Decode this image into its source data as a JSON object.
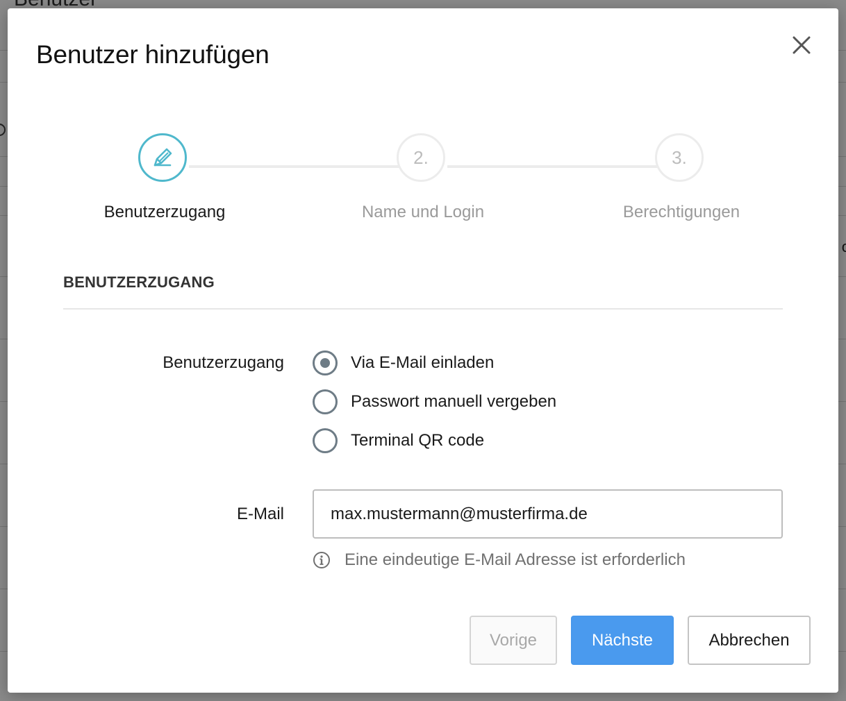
{
  "background": {
    "page_title": "Benutzer"
  },
  "modal": {
    "title": "Benutzer hinzufügen",
    "close_icon": "close-icon",
    "steps": [
      {
        "label": "Benutzerzugang",
        "marker": "",
        "icon": "pencil-icon",
        "state": "active"
      },
      {
        "label": "Name und Login",
        "marker": "2.",
        "state": "inactive"
      },
      {
        "label": "Berechtigungen",
        "marker": "3.",
        "state": "inactive"
      }
    ],
    "section_heading": "BENUTZERZUGANG",
    "access": {
      "label": "Benutzerzugang",
      "options": [
        {
          "label": "Via E-Mail einladen",
          "selected": true
        },
        {
          "label": "Passwort manuell vergeben",
          "selected": false
        },
        {
          "label": "Terminal QR code",
          "selected": false
        }
      ]
    },
    "email": {
      "label": "E-Mail",
      "value": "max.mustermann@musterfirma.de",
      "hint_icon": "info-icon",
      "hint": "Eine eindeutige E-Mail Adresse ist erforderlich"
    },
    "buttons": {
      "prev": "Vorige",
      "next": "Nächste",
      "cancel": "Abbrechen"
    },
    "colors": {
      "accent_step": "#4fb8cc",
      "primary_button": "#4a9aee",
      "radio": "#6e7c86"
    }
  }
}
